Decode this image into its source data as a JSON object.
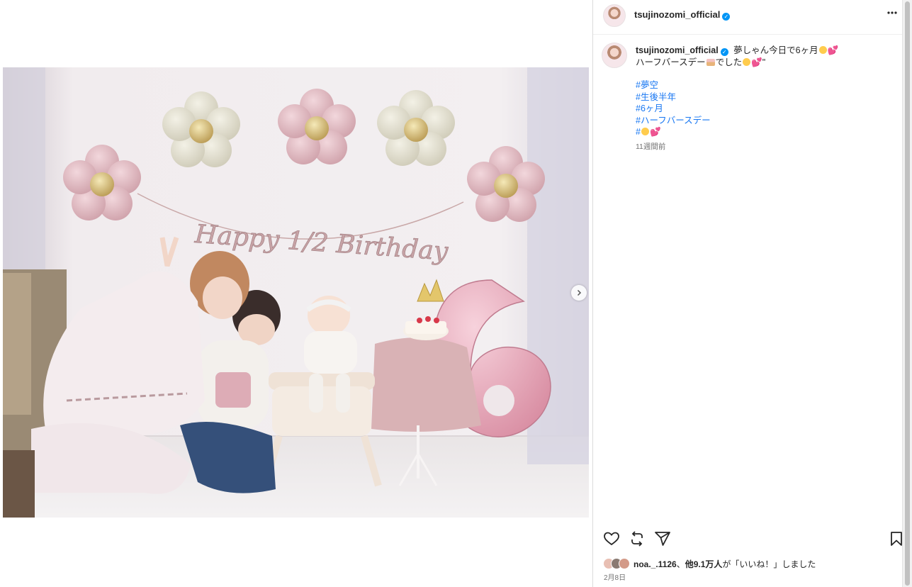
{
  "post": {
    "username": "tsujinozomi_official",
    "caption_line1": "夢しゃん今日で6ヶ月",
    "caption_line2a": "ハーフバースデー",
    "caption_line2b": "でした",
    "caption_tail": "\"",
    "hashtags": [
      "#夢空",
      "#生後半年",
      "#6ヶ月",
      "#ハーフバースデー",
      "#"
    ],
    "time_ago": "11週間前",
    "liked_by_user": "noa._.1126",
    "likes_sep": "、",
    "likes_count": "他9.1万人",
    "likes_suffix": "が「いいね！」しました",
    "date": "2月8日"
  },
  "photo": {
    "banner_text": "Happy 1/2 Birthday",
    "balloon_number": "6"
  },
  "icons": {
    "more": "more-horizontal-icon",
    "like": "heart-icon",
    "repost": "repost-icon",
    "share": "send-icon",
    "save": "bookmark-icon",
    "next": "chevron-right-icon"
  },
  "colors": {
    "link": "#1877f2",
    "verified": "#0095f6",
    "muted": "#737373"
  }
}
